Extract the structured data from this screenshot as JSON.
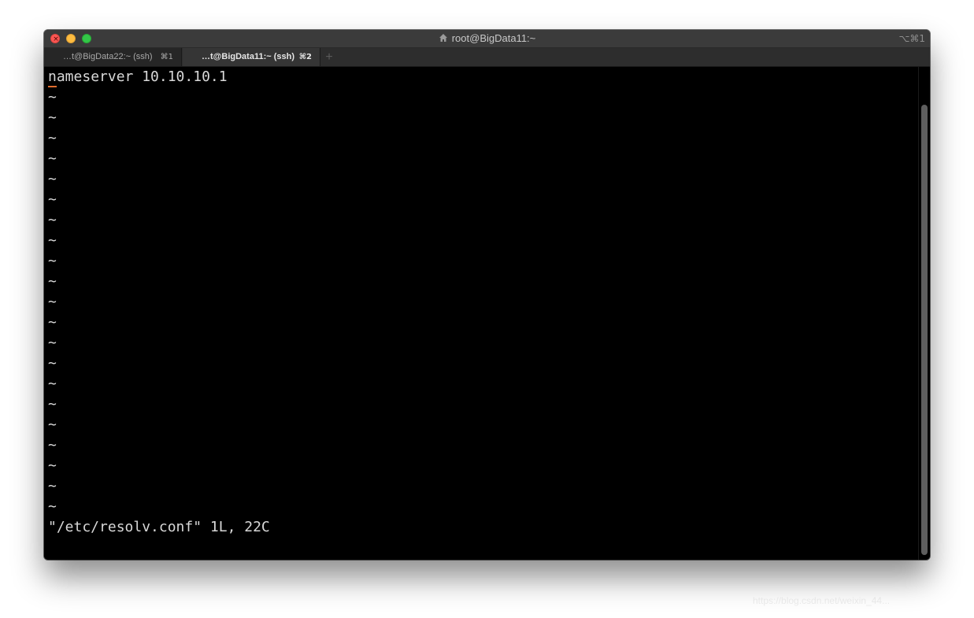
{
  "window": {
    "title": "root@BigData11:~",
    "title_icon": "home-icon",
    "shortcut": "⌥⌘1"
  },
  "tabs": [
    {
      "label": "…t@BigData22:~ (ssh)",
      "key": "⌘1",
      "active": false
    },
    {
      "label": "…t@BigData11:~ (ssh)",
      "key": "⌘2",
      "active": true
    }
  ],
  "tab_add_label": "+",
  "terminal": {
    "first_line_cursor_char": "n",
    "first_line_rest": "ameserver 10.10.10.1",
    "tilde_char": "~",
    "tilde_count": 21,
    "status_line": "\"/etc/resolv.conf\" 1L, 22C"
  },
  "colors": {
    "cursor": "#e06c2e",
    "close": "#fc5753",
    "minimize": "#fdbc40",
    "maximize": "#33c748"
  },
  "watermark": "https://blog.csdn.net/weixin_44..."
}
